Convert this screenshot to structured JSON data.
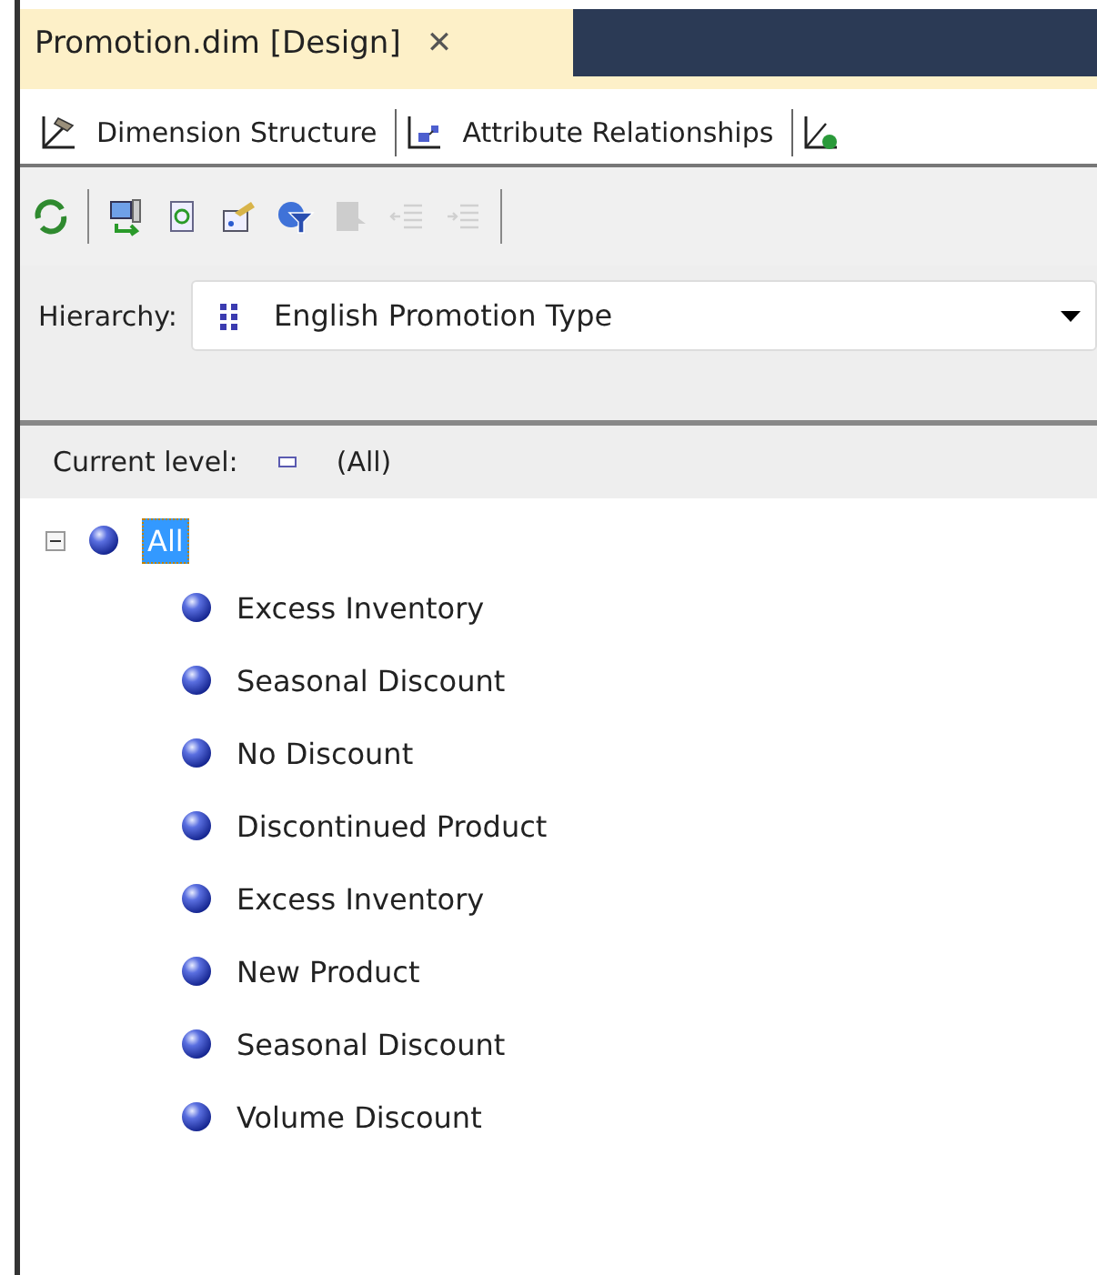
{
  "document_tab": {
    "title": "Promotion.dim [Design]",
    "close": "✕"
  },
  "designer_tabs": [
    {
      "label": "Dimension Structure"
    },
    {
      "label": "Attribute Relationships"
    }
  ],
  "toolbar": [
    {
      "disabled": false
    },
    {
      "disabled": false
    },
    {
      "disabled": false
    },
    {
      "disabled": false
    },
    {
      "disabled": false
    },
    {
      "disabled": true
    },
    {
      "disabled": true
    },
    {
      "disabled": true
    }
  ],
  "hierarchy": {
    "label": "Hierarchy:",
    "value": "English Promotion Type"
  },
  "current_level": {
    "label": "Current level:",
    "value": "(All)"
  },
  "tree": [
    {
      "label": "All",
      "expanded": true,
      "selected": true,
      "children": [
        {
          "label": "Excess Inventory",
          "selected": false
        },
        {
          "label": "Seasonal Discount",
          "selected": false
        },
        {
          "label": "No Discount",
          "selected": false
        },
        {
          "label": "Discontinued Product",
          "selected": false
        },
        {
          "label": "Excess Inventory",
          "selected": false
        },
        {
          "label": "New Product",
          "selected": false
        },
        {
          "label": "Seasonal Discount",
          "selected": false
        },
        {
          "label": "Volume Discount",
          "selected": false
        }
      ]
    }
  ]
}
